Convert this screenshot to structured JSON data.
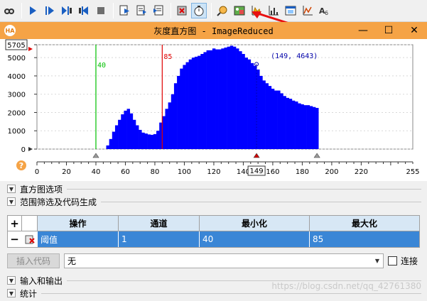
{
  "window": {
    "title": "灰度直方图 - ImageReduced",
    "app_badge": "HA",
    "min_label": "—",
    "max_label": "☐",
    "close_label": "✕"
  },
  "toolbar": {
    "buttons": [
      "camera-icon",
      "run-icon",
      "step-icon",
      "step-over-icon",
      "step-back-icon",
      "stop-icon",
      "insert-icon",
      "next-icon",
      "breakpoint-icon",
      "reset-icon",
      "timer-icon",
      "zoom-icon",
      "image-icon",
      "histogram-icon",
      "graph-icon",
      "window-icon",
      "feature-icon",
      "ocr-icon"
    ]
  },
  "histogram": {
    "y_ticks": [
      "5705",
      "5000",
      "4000",
      "3000",
      "2000",
      "1000",
      "0"
    ],
    "y_max_box": "5705",
    "x_ticks": [
      "0",
      "20",
      "40",
      "60",
      "80",
      "100",
      "120",
      "140",
      "160",
      "180",
      "200",
      "220",
      "255"
    ],
    "current_value_box": "149",
    "threshold_min_label": "40",
    "threshold_max_label": "85",
    "cursor_label": "(149, 4643)",
    "accent_min": "#00c000",
    "accent_max": "#e00000",
    "bar_color": "#0000ff",
    "help_icon": "?"
  },
  "chart_data": {
    "type": "bar",
    "title": "",
    "xlabel": "",
    "ylabel": "",
    "xlim": [
      0,
      255
    ],
    "ylim": [
      0,
      5705
    ],
    "min_threshold": 40,
    "max_threshold": 85,
    "cursor": {
      "x": 149,
      "y": 4643
    },
    "x": [
      48,
      50,
      52,
      54,
      56,
      58,
      60,
      62,
      64,
      66,
      68,
      70,
      72,
      74,
      76,
      78,
      80,
      82,
      84,
      86,
      88,
      90,
      92,
      94,
      96,
      98,
      100,
      102,
      104,
      106,
      108,
      110,
      112,
      114,
      116,
      118,
      120,
      122,
      124,
      126,
      128,
      130,
      132,
      134,
      136,
      138,
      140,
      142,
      144,
      146,
      148,
      150,
      152,
      154,
      156,
      158,
      160,
      162,
      164,
      166,
      168,
      170,
      172,
      174,
      176,
      178,
      180,
      182,
      184,
      186,
      188,
      190
    ],
    "values": [
      200,
      550,
      950,
      1300,
      1600,
      1900,
      2100,
      2200,
      1950,
      1600,
      1300,
      1050,
      900,
      850,
      800,
      780,
      820,
      1000,
      1450,
      1800,
      2200,
      2550,
      3000,
      3600,
      4000,
      4400,
      4600,
      4750,
      4900,
      5000,
      5050,
      5100,
      5200,
      5300,
      5400,
      5400,
      5500,
      5450,
      5450,
      5500,
      5550,
      5600,
      5650,
      5600,
      5500,
      5350,
      5200,
      5000,
      4900,
      4700,
      4550,
      4350,
      4000,
      3750,
      3600,
      3450,
      3300,
      3200,
      3200,
      3050,
      2900,
      2800,
      2750,
      2650,
      2600,
      2500,
      2450,
      2400,
      2400,
      2350,
      2300,
      2250
    ]
  },
  "sections": {
    "hist_options": "直方图选项",
    "range_filter": "范围筛选及代码生成",
    "io": "输入和输出",
    "stats": "统计"
  },
  "table": {
    "add_label": "+",
    "remove_label": "−",
    "headers": [
      "操作",
      "通道",
      "最小化",
      "最大化"
    ],
    "row": {
      "operation": "阈值",
      "channel": "1",
      "min": "40",
      "max": "85"
    }
  },
  "controls": {
    "insert_code": "插入代码",
    "operation_value": "无",
    "connect_label": "连接"
  },
  "watermark": "https://blog.csdn.net/qq_42761380"
}
